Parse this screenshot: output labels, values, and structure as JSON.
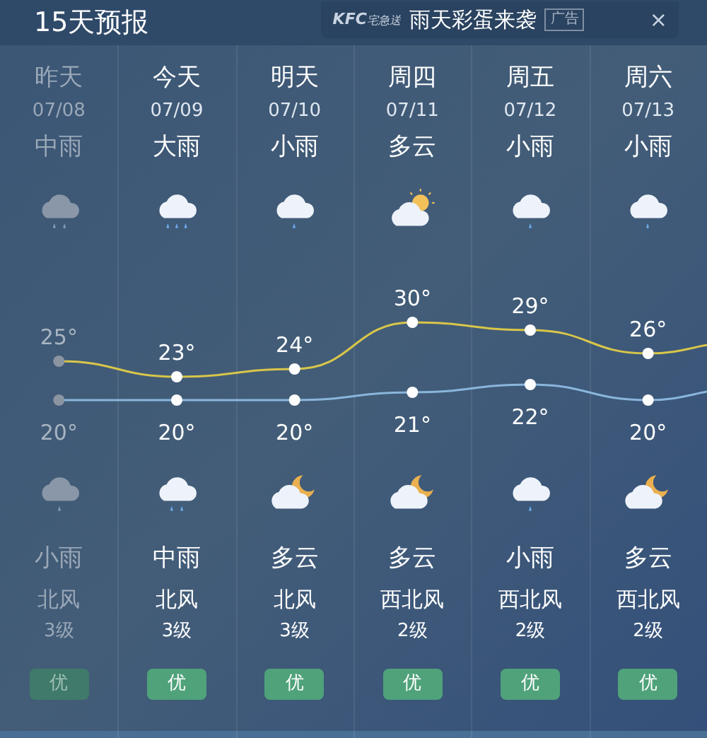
{
  "title": "15天预报",
  "ad": {
    "brand": "KFC",
    "brand_sub": "宅急送",
    "text": "雨天彩蛋来袭",
    "badge": "广告",
    "close": "×"
  },
  "days": [
    {
      "name": "昨天",
      "date": "07/08",
      "day_weather": "中雨",
      "day_icon": {
        "kind": "rain-moderate"
      },
      "high": "25°",
      "low": "20°",
      "night_icon": {
        "kind": "rain-light"
      },
      "night_weather": "小雨",
      "wind": "北风",
      "wind_level": "3级",
      "aqi": "优",
      "past": true
    },
    {
      "name": "今天",
      "date": "07/09",
      "day_weather": "大雨",
      "day_icon": {
        "kind": "rain-heavy"
      },
      "high": "23°",
      "low": "20°",
      "night_icon": {
        "kind": "rain-moderate"
      },
      "night_weather": "中雨",
      "wind": "北风",
      "wind_level": "3级",
      "aqi": "优",
      "past": false
    },
    {
      "name": "明天",
      "date": "07/10",
      "day_weather": "小雨",
      "day_icon": {
        "kind": "rain-light"
      },
      "high": "24°",
      "low": "20°",
      "night_icon": {
        "kind": "cloudy-night"
      },
      "night_weather": "多云",
      "wind": "北风",
      "wind_level": "3级",
      "aqi": "优",
      "past": false
    },
    {
      "name": "周四",
      "date": "07/11",
      "day_weather": "多云",
      "day_icon": {
        "kind": "cloudy-day"
      },
      "high": "30°",
      "low": "21°",
      "night_icon": {
        "kind": "cloudy-night"
      },
      "night_weather": "多云",
      "wind": "西北风",
      "wind_level": "2级",
      "aqi": "优",
      "past": false
    },
    {
      "name": "周五",
      "date": "07/12",
      "day_weather": "小雨",
      "day_icon": {
        "kind": "rain-light"
      },
      "high": "29°",
      "low": "22°",
      "night_icon": {
        "kind": "rain-light"
      },
      "night_weather": "小雨",
      "wind": "西北风",
      "wind_level": "2级",
      "aqi": "优",
      "past": false
    },
    {
      "name": "周六",
      "date": "07/13",
      "day_weather": "小雨",
      "day_icon": {
        "kind": "rain-light"
      },
      "high": "26°",
      "low": "20°",
      "night_icon": {
        "kind": "cloudy-night"
      },
      "night_weather": "多云",
      "wind": "西北风",
      "wind_level": "2级",
      "aqi": "优",
      "past": false
    }
  ]
}
